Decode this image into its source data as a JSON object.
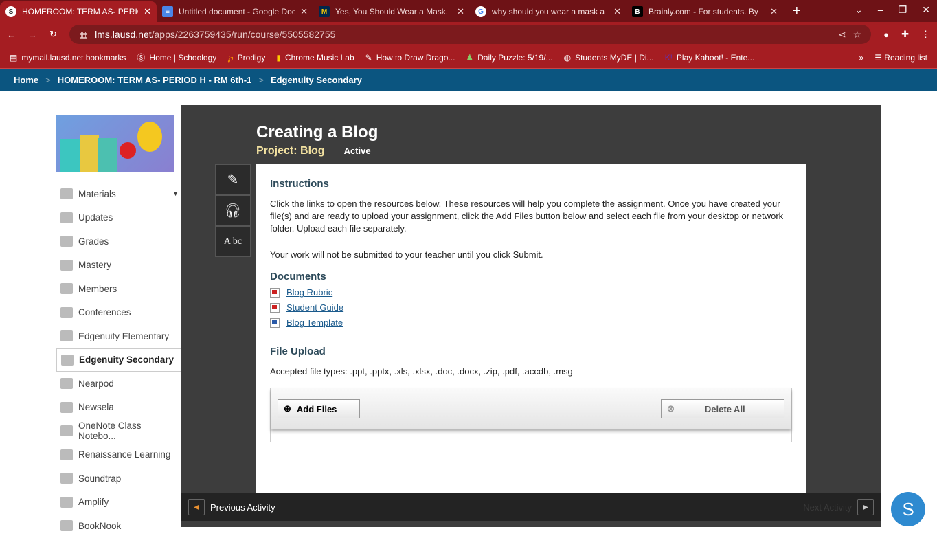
{
  "browser": {
    "tabs": [
      {
        "icon": "S",
        "title": "HOMEROOM: TERM AS- PERIOD H"
      },
      {
        "icon": "≡",
        "title": "Untitled document - Google Docs"
      },
      {
        "icon": "M",
        "title": "Yes, You Should Wear a Mask."
      },
      {
        "icon": "G",
        "title": "why should you wear a mask a"
      },
      {
        "icon": "B",
        "title": "Brainly.com - For students. By"
      }
    ],
    "url_host": "lms.lausd.net",
    "url_path": "/apps/2263759435/run/course/5505582755",
    "bookmarks": [
      "mymail.lausd.net bookmarks",
      "Home | Schoology",
      "Prodigy",
      "Chrome Music Lab",
      "How to Draw Drago...",
      "Daily Puzzle: 5/19/...",
      "Students MyDE | Di...",
      "Play Kahoot! - Ente..."
    ],
    "reading_list": "Reading list"
  },
  "breadcrumb": [
    "Home",
    "HOMEROOM: TERM AS- PERIOD H - RM 6th-1",
    "Edgenuity Secondary"
  ],
  "sidebar": [
    "Materials",
    "Updates",
    "Grades",
    "Mastery",
    "Members",
    "Conferences",
    "Edgenuity Elementary",
    "Edgenuity Secondary",
    "Nearpod",
    "Newsela",
    "OneNote Class Notebo...",
    "Renaissance Learning",
    "Soundtrap",
    "Amplify",
    "BookNook"
  ],
  "activity": {
    "title": "Creating a Blog",
    "project": "Project: Blog",
    "status": "Active",
    "instructions_heading": "Instructions",
    "instructions": "Click the links to open the resources below. These resources will help you complete the assignment. Once you have created your file(s) and are ready to upload your assignment, click the Add Files button below and select each file from your desktop or network folder. Upload each file separately.",
    "note": "Your work will not be submitted to your teacher until you click Submit.",
    "documents_heading": "Documents",
    "documents": [
      "Blog Rubric",
      "Student Guide",
      "Blog Template"
    ],
    "upload_heading": "File Upload",
    "accepted": "Accepted file types: .ppt, .pptx, .xls, .xlsx, .doc, .docx, .zip, .pdf, .accdb, .msg",
    "add_files": "Add Files",
    "delete_all": "Delete All"
  },
  "footer": {
    "prev": "Previous Activity",
    "next": "Next Activity"
  },
  "fab": "S"
}
